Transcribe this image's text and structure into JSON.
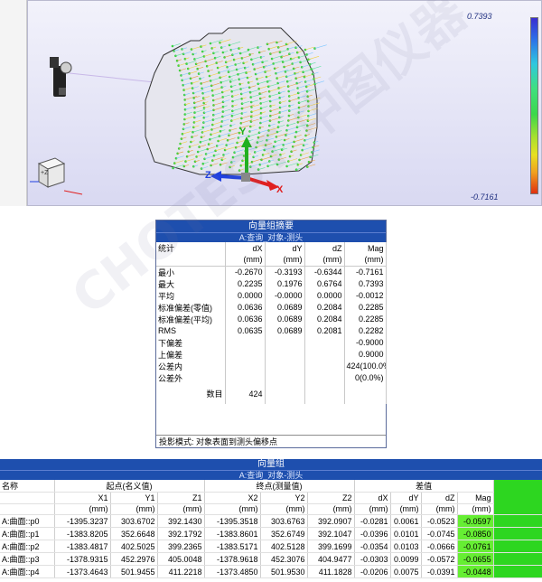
{
  "viewport": {
    "colorbar_max": "0.7393",
    "colorbar_min": "-0.7161",
    "axis_x": "X",
    "axis_y": "Y",
    "axis_z": "Z",
    "view_cube_label": "+Z",
    "colors": {
      "x_axis": "#e02020",
      "y_axis": "#20b020",
      "z_axis": "#2040e0"
    }
  },
  "summary": {
    "title": "向量组摘要",
    "subtitle": "A:查询_对象-测头",
    "columns": [
      "统计",
      "dX",
      "dY",
      "dZ",
      "Mag"
    ],
    "unit": "(mm)",
    "rows": [
      {
        "label": "最小",
        "dx": "-0.2670",
        "dy": "-0.3193",
        "dz": "-0.6344",
        "mag": "-0.7161"
      },
      {
        "label": "最大",
        "dx": "0.2235",
        "dy": "0.1976",
        "dz": "0.6764",
        "mag": "0.7393"
      },
      {
        "label": "平均",
        "dx": "0.0000",
        "dy": "-0.0000",
        "dz": "0.0000",
        "mag": "-0.0012"
      },
      {
        "label": "标准偏差(零值)",
        "dx": "0.0636",
        "dy": "0.0689",
        "dz": "0.2084",
        "mag": "0.2285"
      },
      {
        "label": "标准偏差(平均)",
        "dx": "0.0636",
        "dy": "0.0689",
        "dz": "0.2084",
        "mag": "0.2285"
      },
      {
        "label": "RMS",
        "dx": "0.0635",
        "dy": "0.0689",
        "dz": "0.2081",
        "mag": "0.2282"
      },
      {
        "label": "下偏差",
        "dx": "",
        "dy": "",
        "dz": "",
        "mag": "-0.9000"
      },
      {
        "label": "上偏差",
        "dx": "",
        "dy": "",
        "dz": "",
        "mag": "0.9000"
      },
      {
        "label": "公差内",
        "dx": "",
        "dy": "",
        "dz": "",
        "mag": "424(100.0%)"
      },
      {
        "label": "公差外",
        "dx": "",
        "dy": "",
        "dz": "",
        "mag": "0(0.0%)"
      }
    ],
    "count_label": "数目",
    "count_value": "424",
    "footer": "投影模式: 对象表面到测头偏移点"
  },
  "vector_table": {
    "title": "向量组",
    "subtitle": "A:查询_对象-测头",
    "group_name": "名称",
    "group_start": "起点(名义值)",
    "group_end": "终点(测量值)",
    "group_diff": "差值",
    "columns": [
      "X1",
      "Y1",
      "Z1",
      "X2",
      "Y2",
      "Z2",
      "dX",
      "dY",
      "dZ",
      "Mag"
    ],
    "unit": "(mm)",
    "rows": [
      {
        "name": "A:曲面::p0",
        "x1": "-1395.3237",
        "y1": "303.6702",
        "z1": "392.1430",
        "x2": "-1395.3518",
        "y2": "303.6763",
        "z2": "392.0907",
        "dx": "-0.0281",
        "dy": "0.0061",
        "dz": "-0.0523",
        "mag": "-0.0597"
      },
      {
        "name": "A:曲面::p1",
        "x1": "-1383.8205",
        "y1": "352.6648",
        "z1": "392.1792",
        "x2": "-1383.8601",
        "y2": "352.6749",
        "z2": "392.1047",
        "dx": "-0.0396",
        "dy": "0.0101",
        "dz": "-0.0745",
        "mag": "-0.0850"
      },
      {
        "name": "A:曲面::p2",
        "x1": "-1383.4817",
        "y1": "402.5025",
        "z1": "399.2365",
        "x2": "-1383.5171",
        "y2": "402.5128",
        "z2": "399.1699",
        "dx": "-0.0354",
        "dy": "0.0103",
        "dz": "-0.0666",
        "mag": "-0.0761"
      },
      {
        "name": "A:曲面::p3",
        "x1": "-1378.9315",
        "y1": "452.2976",
        "z1": "405.0048",
        "x2": "-1378.9618",
        "y2": "452.3076",
        "z2": "404.9477",
        "dx": "-0.0303",
        "dy": "0.0099",
        "dz": "-0.0572",
        "mag": "-0.0655"
      },
      {
        "name": "A:曲面::p4",
        "x1": "-1373.4643",
        "y1": "501.9455",
        "z1": "411.2218",
        "x2": "-1373.4850",
        "y2": "501.9530",
        "z2": "411.1828",
        "dx": "-0.0206",
        "dy": "0.0075",
        "dz": "-0.0391",
        "mag": "-0.0448"
      }
    ]
  },
  "watermark": "CHOTEST 中图仪器"
}
